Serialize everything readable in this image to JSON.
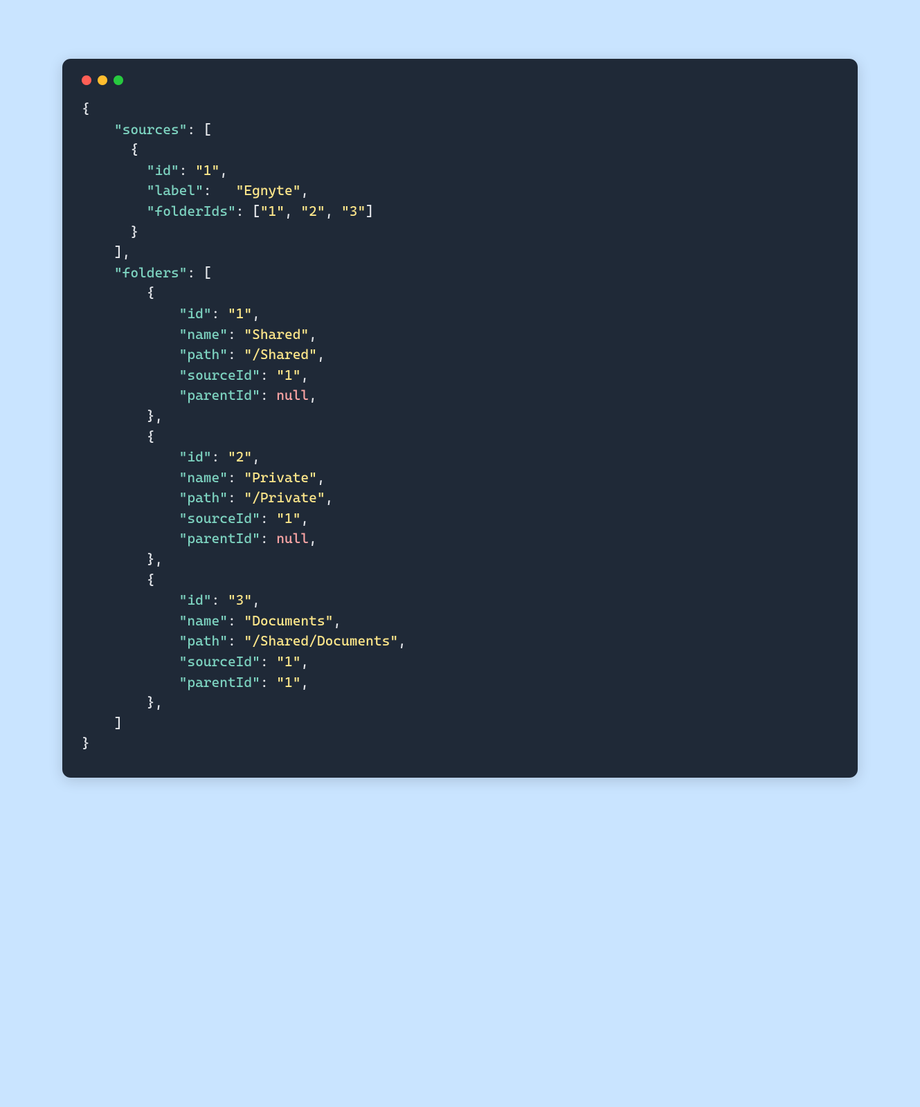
{
  "window": {
    "buttons": [
      "close",
      "minimize",
      "zoom"
    ]
  },
  "code": {
    "tokens": [
      {
        "t": "punc",
        "v": "{"
      },
      "NL",
      {
        "t": "punc",
        "v": "    "
      },
      {
        "t": "key",
        "v": "\"sources\""
      },
      {
        "t": "punc",
        "v": ": ["
      },
      "NL",
      {
        "t": "punc",
        "v": "      {"
      },
      "NL",
      {
        "t": "punc",
        "v": "        "
      },
      {
        "t": "key",
        "v": "\"id\""
      },
      {
        "t": "punc",
        "v": ": "
      },
      {
        "t": "str",
        "v": "\"1\""
      },
      {
        "t": "punc",
        "v": ","
      },
      "NL",
      {
        "t": "punc",
        "v": "        "
      },
      {
        "t": "key",
        "v": "\"label\""
      },
      {
        "t": "punc",
        "v": ":   "
      },
      {
        "t": "str",
        "v": "\"Egnyte\""
      },
      {
        "t": "punc",
        "v": ","
      },
      "NL",
      {
        "t": "punc",
        "v": "        "
      },
      {
        "t": "key",
        "v": "\"folderIds\""
      },
      {
        "t": "punc",
        "v": ": ["
      },
      {
        "t": "str",
        "v": "\"1\""
      },
      {
        "t": "punc",
        "v": ", "
      },
      {
        "t": "str",
        "v": "\"2\""
      },
      {
        "t": "punc",
        "v": ", "
      },
      {
        "t": "str",
        "v": "\"3\""
      },
      {
        "t": "punc",
        "v": "]"
      },
      "NL",
      {
        "t": "punc",
        "v": "      }"
      },
      "NL",
      {
        "t": "punc",
        "v": "    ],"
      },
      "NL",
      {
        "t": "punc",
        "v": "    "
      },
      {
        "t": "key",
        "v": "\"folders\""
      },
      {
        "t": "punc",
        "v": ": ["
      },
      "NL",
      {
        "t": "punc",
        "v": "        {"
      },
      "NL",
      {
        "t": "punc",
        "v": "            "
      },
      {
        "t": "key",
        "v": "\"id\""
      },
      {
        "t": "punc",
        "v": ": "
      },
      {
        "t": "str",
        "v": "\"1\""
      },
      {
        "t": "punc",
        "v": ","
      },
      "NL",
      {
        "t": "punc",
        "v": "            "
      },
      {
        "t": "key",
        "v": "\"name\""
      },
      {
        "t": "punc",
        "v": ": "
      },
      {
        "t": "str",
        "v": "\"Shared\""
      },
      {
        "t": "punc",
        "v": ","
      },
      "NL",
      {
        "t": "punc",
        "v": "            "
      },
      {
        "t": "key",
        "v": "\"path\""
      },
      {
        "t": "punc",
        "v": ": "
      },
      {
        "t": "str",
        "v": "\"/Shared\""
      },
      {
        "t": "punc",
        "v": ","
      },
      "NL",
      {
        "t": "punc",
        "v": "            "
      },
      {
        "t": "key",
        "v": "\"sourceId\""
      },
      {
        "t": "punc",
        "v": ": "
      },
      {
        "t": "str",
        "v": "\"1\""
      },
      {
        "t": "punc",
        "v": ","
      },
      "NL",
      {
        "t": "punc",
        "v": "            "
      },
      {
        "t": "key",
        "v": "\"parentId\""
      },
      {
        "t": "punc",
        "v": ": "
      },
      {
        "t": "null",
        "v": "null"
      },
      {
        "t": "punc",
        "v": ","
      },
      "NL",
      {
        "t": "punc",
        "v": "        },"
      },
      "NL",
      {
        "t": "punc",
        "v": "        {"
      },
      "NL",
      {
        "t": "punc",
        "v": "            "
      },
      {
        "t": "key",
        "v": "\"id\""
      },
      {
        "t": "punc",
        "v": ": "
      },
      {
        "t": "str",
        "v": "\"2\""
      },
      {
        "t": "punc",
        "v": ","
      },
      "NL",
      {
        "t": "punc",
        "v": "            "
      },
      {
        "t": "key",
        "v": "\"name\""
      },
      {
        "t": "punc",
        "v": ": "
      },
      {
        "t": "str",
        "v": "\"Private\""
      },
      {
        "t": "punc",
        "v": ","
      },
      "NL",
      {
        "t": "punc",
        "v": "            "
      },
      {
        "t": "key",
        "v": "\"path\""
      },
      {
        "t": "punc",
        "v": ": "
      },
      {
        "t": "str",
        "v": "\"/Private\""
      },
      {
        "t": "punc",
        "v": ","
      },
      "NL",
      {
        "t": "punc",
        "v": "            "
      },
      {
        "t": "key",
        "v": "\"sourceId\""
      },
      {
        "t": "punc",
        "v": ": "
      },
      {
        "t": "str",
        "v": "\"1\""
      },
      {
        "t": "punc",
        "v": ","
      },
      "NL",
      {
        "t": "punc",
        "v": "            "
      },
      {
        "t": "key",
        "v": "\"parentId\""
      },
      {
        "t": "punc",
        "v": ": "
      },
      {
        "t": "null",
        "v": "null"
      },
      {
        "t": "punc",
        "v": ","
      },
      "NL",
      {
        "t": "punc",
        "v": "        },"
      },
      "NL",
      {
        "t": "punc",
        "v": "        {"
      },
      "NL",
      {
        "t": "punc",
        "v": "            "
      },
      {
        "t": "key",
        "v": "\"id\""
      },
      {
        "t": "punc",
        "v": ": "
      },
      {
        "t": "str",
        "v": "\"3\""
      },
      {
        "t": "punc",
        "v": ","
      },
      "NL",
      {
        "t": "punc",
        "v": "            "
      },
      {
        "t": "key",
        "v": "\"name\""
      },
      {
        "t": "punc",
        "v": ": "
      },
      {
        "t": "str",
        "v": "\"Documents\""
      },
      {
        "t": "punc",
        "v": ","
      },
      "NL",
      {
        "t": "punc",
        "v": "            "
      },
      {
        "t": "key",
        "v": "\"path\""
      },
      {
        "t": "punc",
        "v": ": "
      },
      {
        "t": "str",
        "v": "\"/Shared/Documents\""
      },
      {
        "t": "punc",
        "v": ","
      },
      "NL",
      {
        "t": "punc",
        "v": "            "
      },
      {
        "t": "key",
        "v": "\"sourceId\""
      },
      {
        "t": "punc",
        "v": ": "
      },
      {
        "t": "str",
        "v": "\"1\""
      },
      {
        "t": "punc",
        "v": ","
      },
      "NL",
      {
        "t": "punc",
        "v": "            "
      },
      {
        "t": "key",
        "v": "\"parentId\""
      },
      {
        "t": "punc",
        "v": ": "
      },
      {
        "t": "str",
        "v": "\"1\""
      },
      {
        "t": "punc",
        "v": ","
      },
      "NL",
      {
        "t": "punc",
        "v": "        },"
      },
      "NL",
      {
        "t": "punc",
        "v": "    ]"
      },
      "NL",
      {
        "t": "punc",
        "v": "}"
      }
    ]
  }
}
